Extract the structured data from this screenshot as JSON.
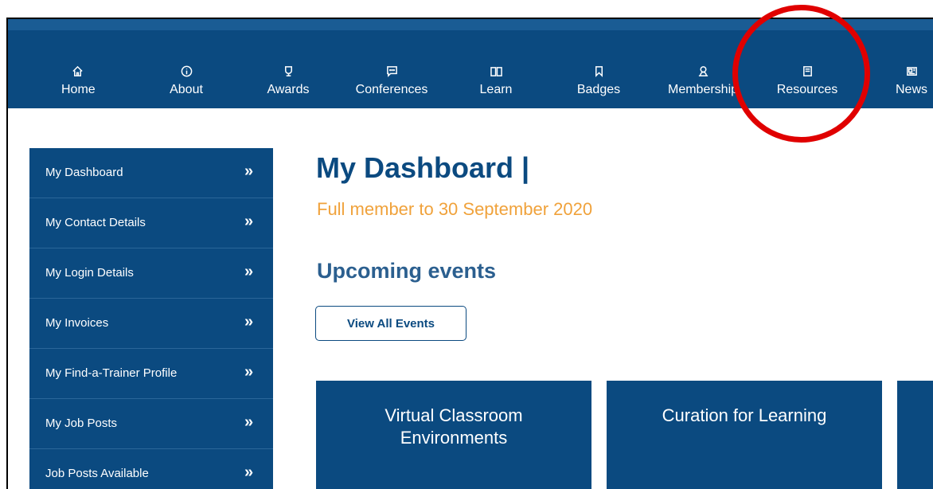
{
  "topnav": {
    "items": [
      {
        "label": "Home",
        "icon": "home-icon"
      },
      {
        "label": "About",
        "icon": "info-icon"
      },
      {
        "label": "Awards",
        "icon": "trophy-icon"
      },
      {
        "label": "Conferences",
        "icon": "chat-icon"
      },
      {
        "label": "Learn",
        "icon": "book-open-icon"
      },
      {
        "label": "Badges",
        "icon": "bookmark-icon"
      },
      {
        "label": "Membership",
        "icon": "user-icon"
      },
      {
        "label": "Resources",
        "icon": "notebook-icon"
      },
      {
        "label": "News",
        "icon": "newspaper-icon"
      }
    ]
  },
  "sidebar": {
    "items": [
      {
        "label": "My Dashboard"
      },
      {
        "label": "My Contact Details"
      },
      {
        "label": "My Login Details"
      },
      {
        "label": "My Invoices"
      },
      {
        "label": "My Find-a-Trainer Profile"
      },
      {
        "label": "My Job Posts"
      },
      {
        "label": "Job Posts Available"
      }
    ],
    "chevron": "»"
  },
  "main": {
    "title": "My Dashboard |",
    "membership": "Full member to 30 September 2020",
    "events_heading": "Upcoming events",
    "view_all_label": "View All Events",
    "cards": [
      {
        "title": "Virtual Classroom Environments"
      },
      {
        "title": "Curation for Learning"
      },
      {
        "title": ""
      }
    ]
  },
  "colors": {
    "navy": "#0b4a80",
    "orange": "#f0a23b",
    "annotation_red": "#e00000"
  }
}
